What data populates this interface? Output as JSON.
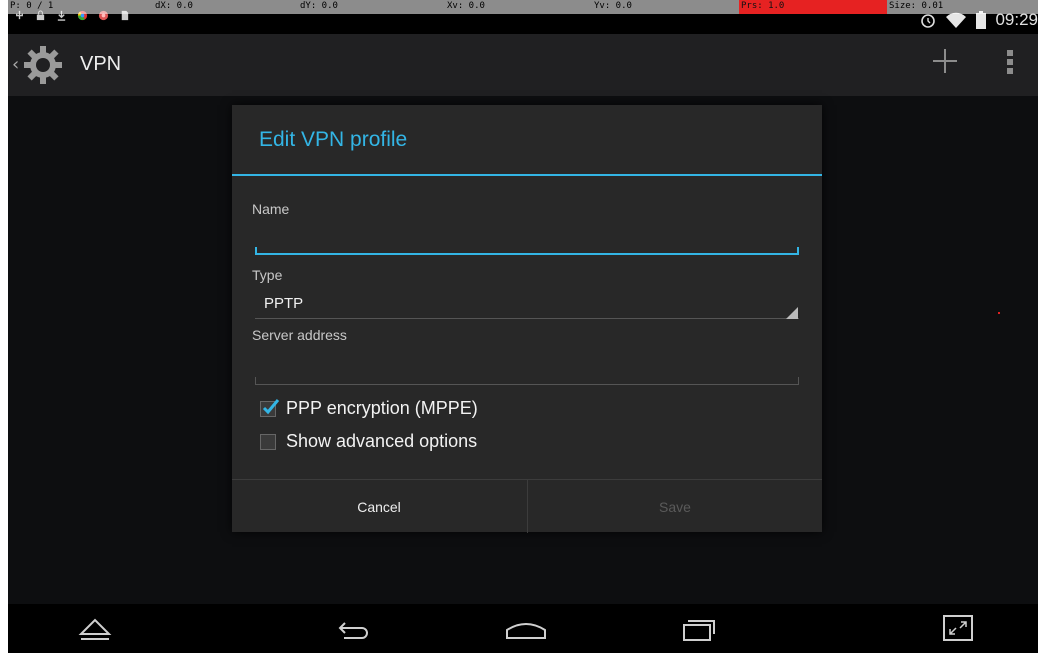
{
  "debug_overlay": {
    "p": "P: 0 / 1",
    "dx": "dX: 0.0",
    "dy": "dY: 0.0",
    "xv": "Xv: 0.0",
    "yv": "Yv: 0.0",
    "prs": "Prs: 1.0",
    "size": "Size: 0.01",
    "prs_color": "#e62222"
  },
  "status_bar": {
    "time": "09:29",
    "left_icons": [
      "usb-icon",
      "lock-icon",
      "download-icon",
      "chrome-icon",
      "app-icon",
      "sd-card-icon"
    ],
    "right_icons": [
      "alarm-icon",
      "wifi-icon",
      "battery-icon"
    ]
  },
  "action_bar": {
    "title": "VPN",
    "icon": "settings-gear-icon"
  },
  "dialog": {
    "title": "Edit VPN profile",
    "name_label": "Name",
    "name_value": "",
    "type_label": "Type",
    "type_value": "PPTP",
    "server_label": "Server address",
    "server_value": "",
    "ppp_encryption_label": "PPP encryption (MPPE)",
    "ppp_encryption_checked": true,
    "advanced_label": "Show advanced options",
    "advanced_checked": false,
    "cancel_label": "Cancel",
    "save_label": "Save"
  },
  "colors": {
    "accent": "#33b5e5",
    "dialog_bg": "#282828",
    "screen_bg": "#111214"
  }
}
